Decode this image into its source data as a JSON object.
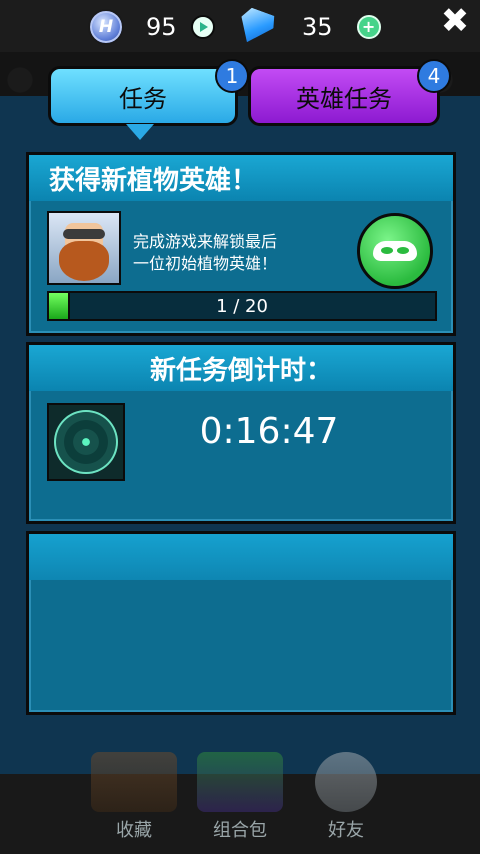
{
  "top_bar": {
    "coin_glyph": "H",
    "coins": "95",
    "gems": "35",
    "plus": "+",
    "close": "✖"
  },
  "tabs": [
    {
      "label": "任务",
      "badge": "1"
    },
    {
      "label": "英雄任务",
      "badge": "4"
    }
  ],
  "quest_card": {
    "title": "获得新植物英雄！",
    "description_line1": "完成游戏来解锁最后",
    "description_line2": "一位初始植物英雄！",
    "progress_text": "1 / 20",
    "progress": 0.05
  },
  "countdown_card": {
    "title": "新任务倒计时：",
    "time": "0:16:47"
  },
  "bottom_nav": [
    {
      "label": "收藏"
    },
    {
      "label": "组合包"
    },
    {
      "label": "好友"
    }
  ]
}
